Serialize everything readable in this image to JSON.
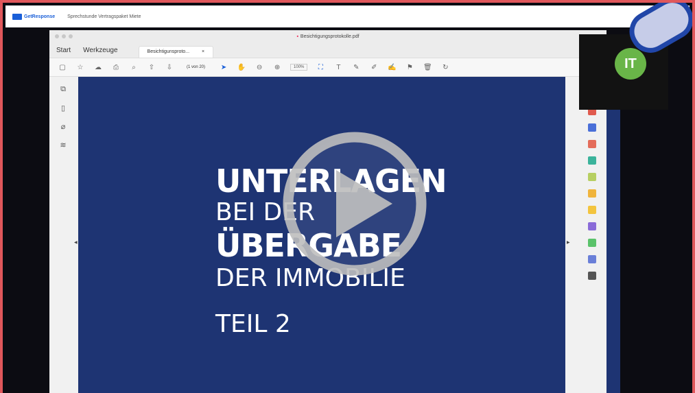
{
  "topbar": {
    "brand": "GetResponse",
    "meeting_title": "Sprechstunde Vertragspaket Miete"
  },
  "window": {
    "title": "Besichtigungsprotokolle.pdf"
  },
  "menu": {
    "start": "Start",
    "tools": "Werkzeuge",
    "tab_label": "Besichtigunsproto...",
    "tab_close": "×"
  },
  "toolbar": {
    "page_indicator": "(1 von 20)",
    "zoom": "100%"
  },
  "slide": {
    "line1": "UNTERLAGEN",
    "line2": "BEI DER",
    "line3": "ÜBERGABE",
    "line4": "DER IMMOBILIE",
    "line5": "TEIL 2"
  },
  "video": {
    "initials": "IT",
    "caption": ""
  },
  "colors": {
    "frame": "#e0575b",
    "slide_bg": "#1e3473",
    "avatar": "#69b548",
    "brand": "#1a5fd8"
  }
}
